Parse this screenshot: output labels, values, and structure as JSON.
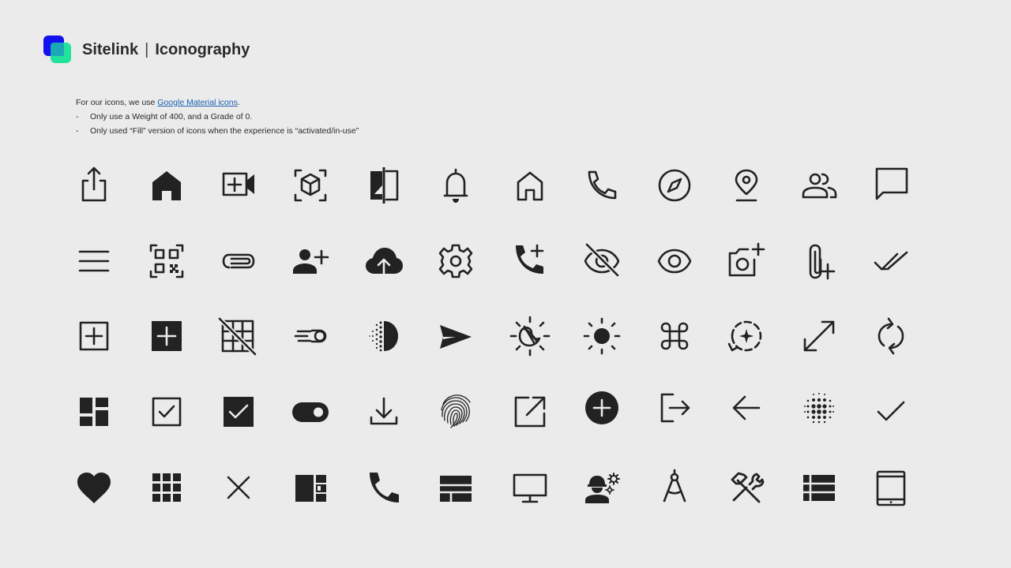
{
  "header": {
    "brand": "Sitelink",
    "separator": "|",
    "subtitle": "Iconography"
  },
  "notes": {
    "intro_prefix": "For our icons, we use ",
    "link_text": "Google Material icons",
    "intro_suffix": ".",
    "bullets": [
      {
        "dash": "-",
        "text": "Only use a Weight of 400, and a Grade of 0."
      },
      {
        "dash": "-",
        "text": "Only used “Fill” version of icons when the experience is “activated/in-use”"
      }
    ]
  },
  "colors": {
    "background": "#ebebeb",
    "icon": "#222222",
    "logo_blue": "#1212ee",
    "logo_green": "#22e39c",
    "link": "#1a5fb4"
  },
  "icon_rows": [
    [
      "ios-share-icon",
      "home-filled-icon",
      "video-call-icon",
      "view-in-ar-icon",
      "compare-icon",
      "notifications-icon",
      "home-outlined-icon",
      "call-outlined-icon",
      "explore-icon",
      "location-on-icon",
      "group-icon",
      "chat-bubble-icon"
    ],
    [
      "menu-icon",
      "qr-code-scanner-icon",
      "attachment-icon",
      "person-add-icon",
      "cloud-upload-icon",
      "settings-icon",
      "add-call-icon",
      "visibility-off-icon",
      "visibility-icon",
      "add-a-photo-icon",
      "attach-file-add-icon",
      "done-all-icon"
    ],
    [
      "add-box-outlined-icon",
      "add-box-filled-icon",
      "grid-off-icon",
      "speed-toggle-icon",
      "contrast-icon",
      "send-icon",
      "brightness-night-icon",
      "light-mode-icon",
      "keyboard-command-icon",
      "sync-sparkle-icon",
      "open-in-full-icon",
      "sync-icon"
    ],
    [
      "dashboard-icon",
      "check-box-outlined-icon",
      "check-box-filled-icon",
      "toggle-on-icon",
      "download-icon",
      "fingerprint-icon",
      "open-in-new-icon",
      "add-circle-filled-icon",
      "logout-icon",
      "arrow-back-icon",
      "blur-on-icon",
      "check-icon"
    ],
    [
      "favorite-filled-icon",
      "apps-icon",
      "close-icon",
      "view-quilt-icon",
      "call-filled-icon",
      "web-icon",
      "desktop-icon",
      "engineering-icon",
      "architecture-icon",
      "construction-icon",
      "view-list-icon",
      "tablet-icon"
    ]
  ]
}
